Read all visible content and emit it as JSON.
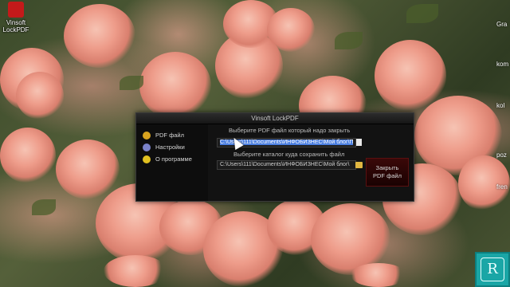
{
  "desktop": {
    "icons": [
      {
        "label": "Vinsoft LockPDF",
        "icon": "lockpdf-app-icon"
      }
    ],
    "right_labels": [
      "Gra",
      "kom",
      "kol",
      "poz",
      "fren"
    ]
  },
  "app": {
    "title": "Vinsoft LockPDF",
    "sidebar": [
      {
        "label": "PDF файл",
        "icon": "pdf-file-icon",
        "color": "#d9a31f"
      },
      {
        "label": "Настройки",
        "icon": "settings-icon",
        "color": "#7a82c9"
      },
      {
        "label": "О программе",
        "icon": "info-icon",
        "color": "#e0c020"
      }
    ],
    "source": {
      "label": "Выберите PDF файл который надо закрыть",
      "value": "C:\\Users\\111\\Documents\\ИНФОБИЗНЕС\\Мой блог\\П"
    },
    "target": {
      "label": "Выберите каталог куда сохранить файл",
      "value": "C:\\Users\\111\\Documents\\ИНФОБИЗНЕС\\Мой блог\\"
    },
    "lock_button": [
      "Закрыть",
      "PDF файл"
    ]
  },
  "watermark": {
    "letter": "R",
    "color": "#1aa6a6"
  }
}
